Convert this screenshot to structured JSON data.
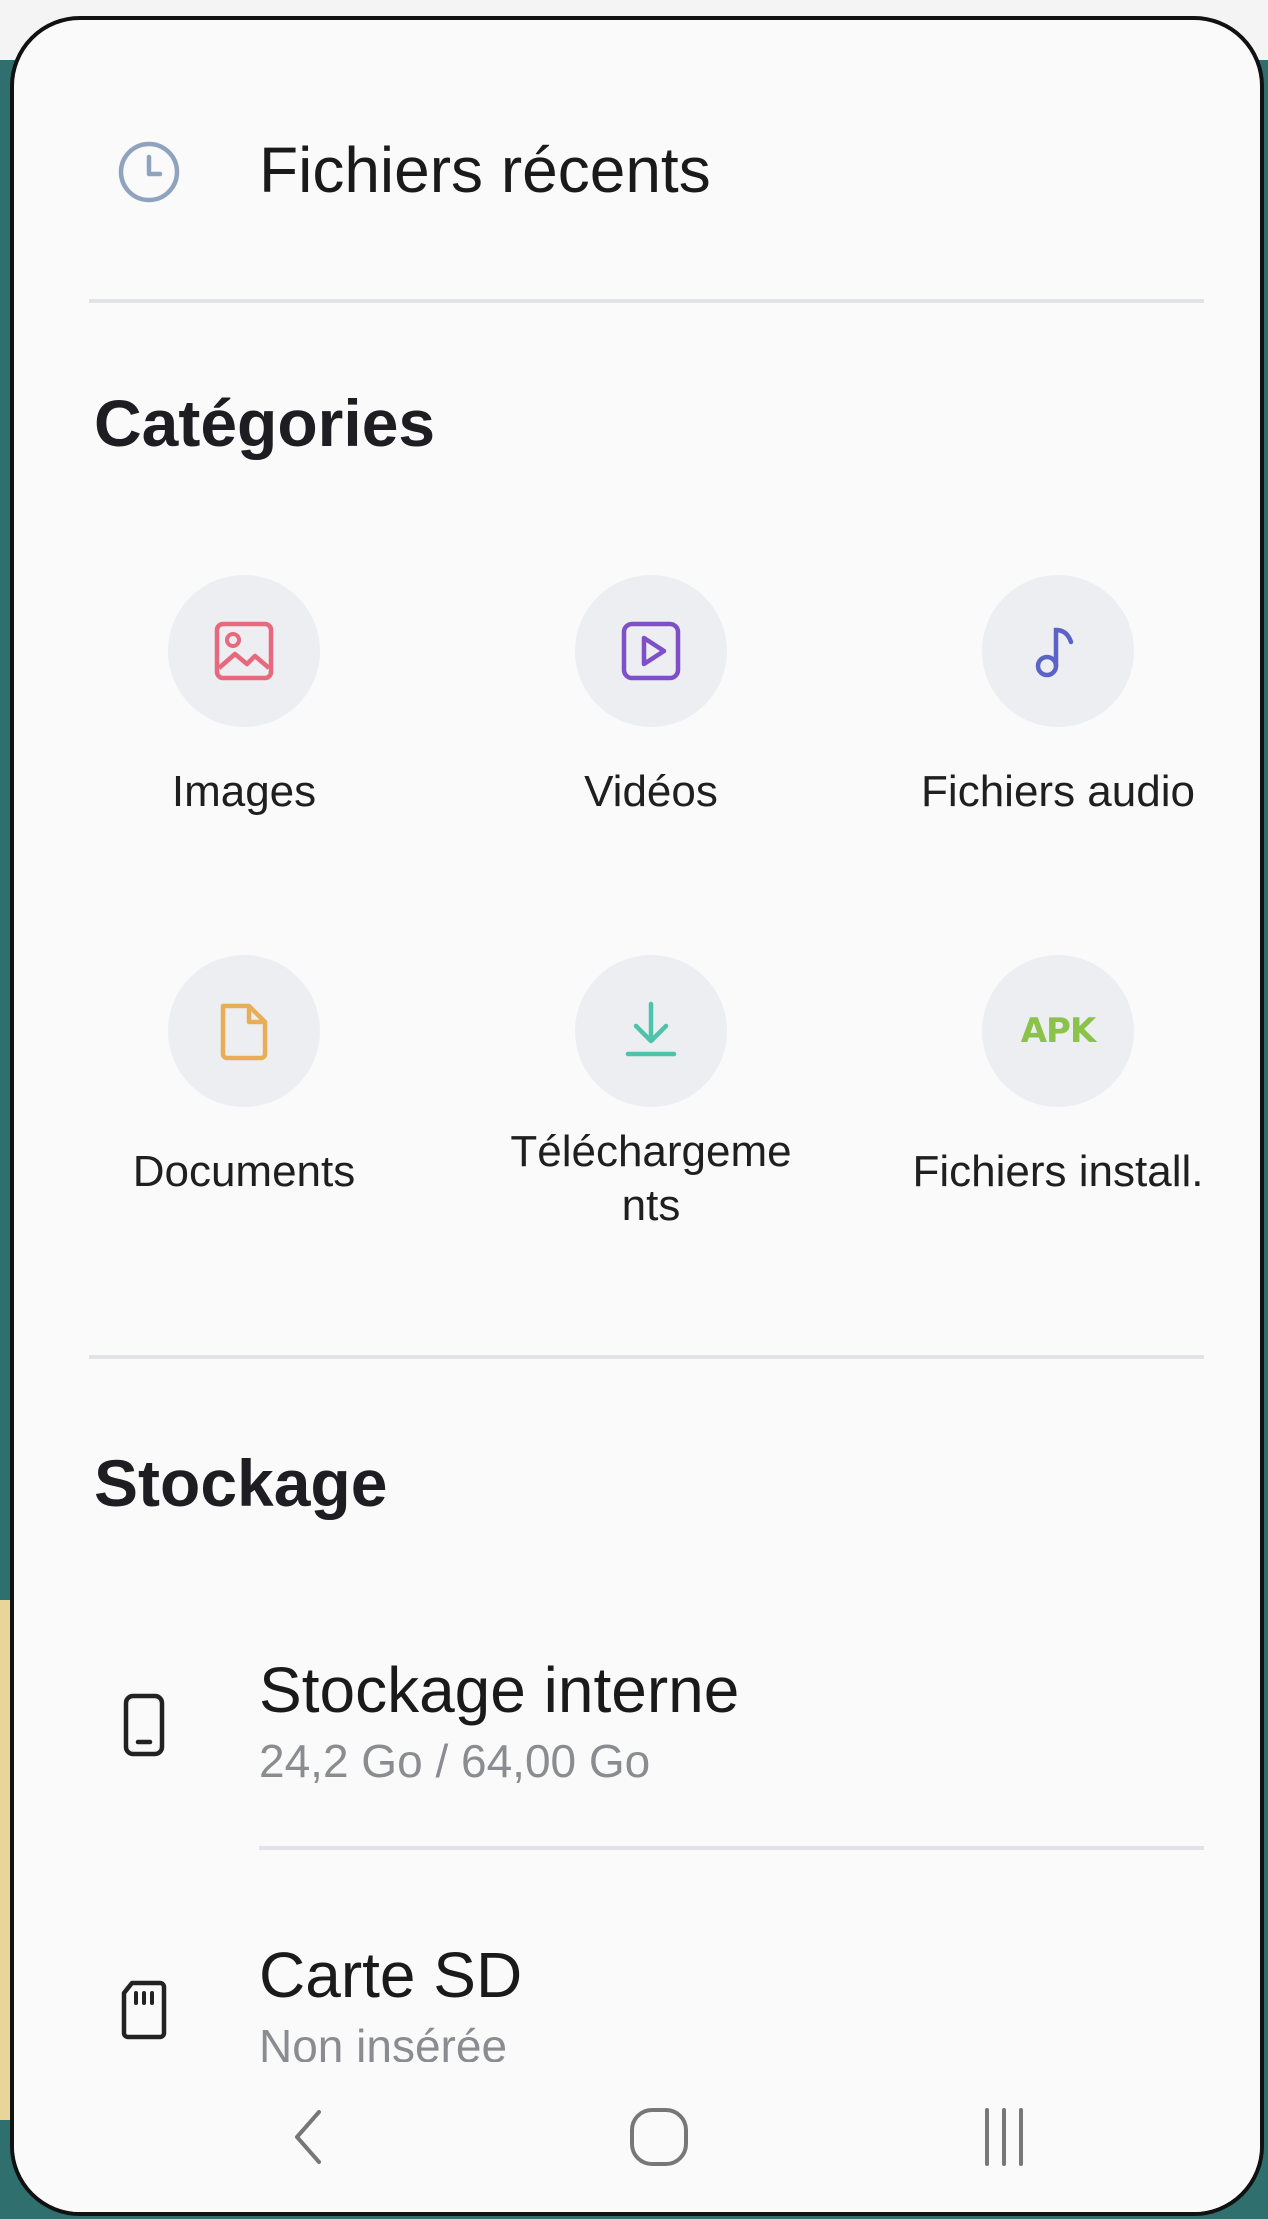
{
  "recent": {
    "label": "Fichiers récents",
    "icon": "clock-icon"
  },
  "categories": {
    "title": "Catégories",
    "items": [
      {
        "label": "Images",
        "icon": "image-icon",
        "color": "#e8687e"
      },
      {
        "label": "Vidéos",
        "icon": "video-play-icon",
        "color": "#7e4fc9"
      },
      {
        "label": "Fichiers audio",
        "icon": "music-note-icon",
        "color": "#5b63c7"
      },
      {
        "label": "Documents",
        "icon": "document-icon",
        "color": "#e7ad57"
      },
      {
        "label": "Téléchargeme\nnts",
        "icon": "download-icon",
        "color": "#4fc3a9"
      },
      {
        "label": "Fichiers install.",
        "icon": "apk-icon",
        "icon_text": "APK",
        "color": "#8bc34a"
      }
    ]
  },
  "storage": {
    "title": "Stockage",
    "items": [
      {
        "title": "Stockage interne",
        "subtitle": "24,2 Go / 64,00 Go",
        "icon": "phone-icon"
      },
      {
        "title": "Carte SD",
        "subtitle": "Non insérée",
        "icon": "sd-card-icon"
      }
    ]
  },
  "navigation": {
    "back": "back-icon",
    "home": "home-icon",
    "recents": "recent-apps-icon"
  }
}
